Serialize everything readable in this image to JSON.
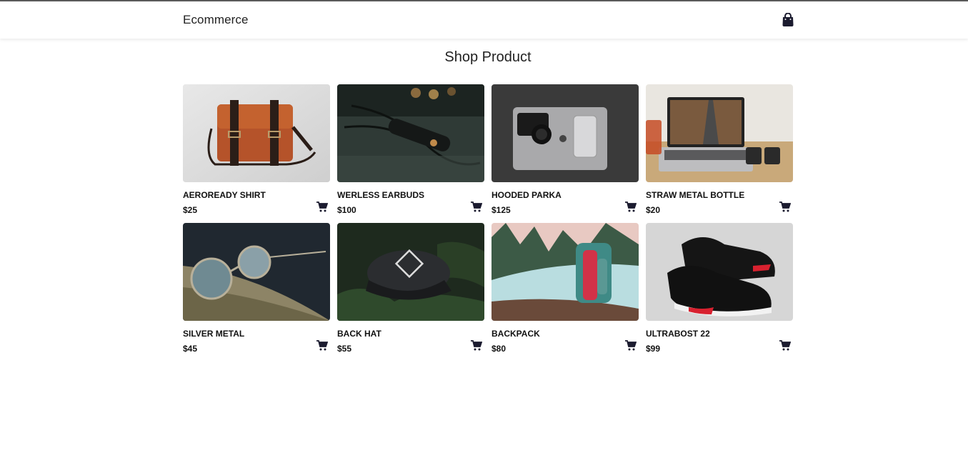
{
  "header": {
    "brand": "Ecommerce",
    "cart_icon": "shopping-bag-icon"
  },
  "page": {
    "title": "Shop Product"
  },
  "products": [
    {
      "name": "AEROREADY SHIRT",
      "price": "$25",
      "image": "leather-bag-photo"
    },
    {
      "name": "WERLESS EARBUDS",
      "price": "$100",
      "image": "earbuds-photo"
    },
    {
      "name": "HOODED PARKA",
      "price": "$125",
      "image": "laptop-camera-phone-photo"
    },
    {
      "name": "STRAW METAL BOTTLE",
      "price": "$20",
      "image": "laptop-desk-photo"
    },
    {
      "name": "SILVER METAL",
      "price": "$45",
      "image": "sunglasses-photo"
    },
    {
      "name": "BACK HAT",
      "price": "$55",
      "image": "cap-photo"
    },
    {
      "name": "BACKPACK",
      "price": "$80",
      "image": "backpack-photo"
    },
    {
      "name": "ULTRABOST 22",
      "price": "$99",
      "image": "sneakers-photo"
    }
  ],
  "colors": {
    "accent": "#1b1b2f",
    "text": "#111111"
  }
}
